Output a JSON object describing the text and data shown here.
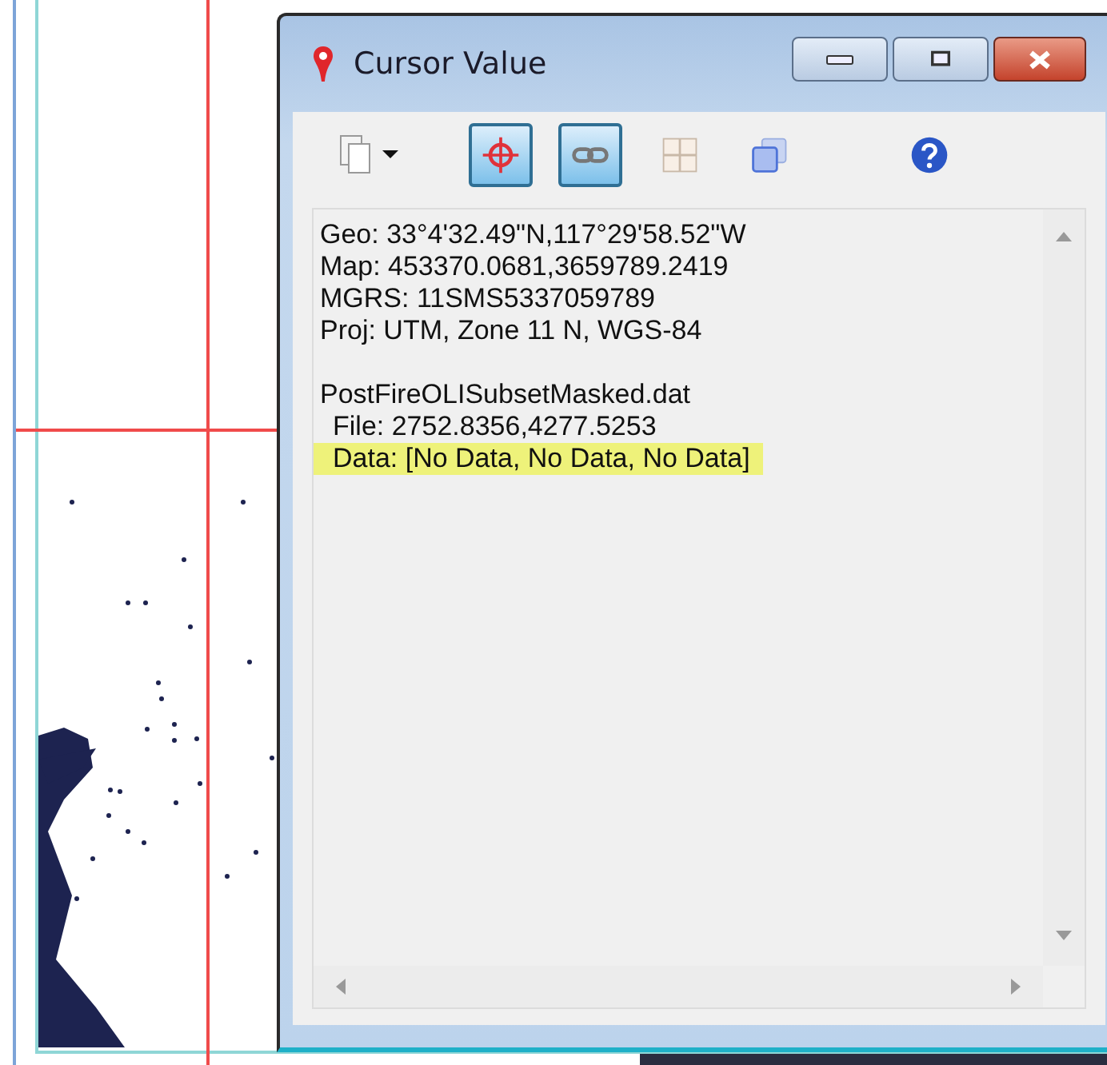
{
  "window": {
    "title": "Cursor Value"
  },
  "toolbar": [
    {
      "kind": "copy",
      "selected": false
    },
    {
      "kind": "crosshair",
      "selected": true
    },
    {
      "kind": "link",
      "selected": true
    },
    {
      "kind": "grid",
      "selected": false
    },
    {
      "kind": "layers",
      "selected": false
    },
    {
      "kind": "help",
      "selected": false
    }
  ],
  "coordinates": [
    "Geo: 33°4'32.49\"N,117°29'58.52\"W",
    "Map: 453370.0681,3659789.2419",
    "MGRS: 11SMS5337059789",
    "Proj: UTM, Zone 11 N, WGS-84"
  ],
  "dataset": {
    "name": "PostFireOLISubsetMasked.dat",
    "children": [
      {
        "text": "File: 2752.8356,4277.5253",
        "highlighted": false
      },
      {
        "text": "Data: [No Data, No Data, No Data]",
        "highlighted": true
      }
    ]
  }
}
